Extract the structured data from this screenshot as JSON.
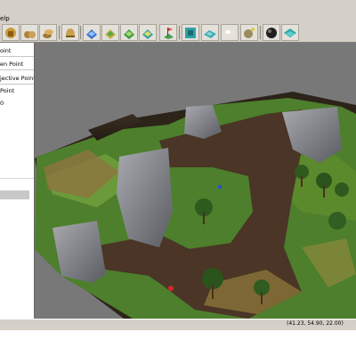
{
  "menu": {
    "help_label": "elp"
  },
  "toolbar": {
    "buttons": [
      {
        "icon": "unit-icon"
      },
      {
        "icon": "bags-icon"
      },
      {
        "icon": "coins-icon"
      },
      {
        "icon": "helmet-icon"
      },
      {
        "icon": "tiles-blue-icon"
      },
      {
        "icon": "tiles-yellow-icon"
      },
      {
        "icon": "tiles-green-icon"
      },
      {
        "icon": "tiles-teal-icon"
      },
      {
        "icon": "flag-icon"
      },
      {
        "icon": "terrain-icon"
      },
      {
        "icon": "cloud-icon"
      },
      {
        "icon": "sound-icon"
      },
      {
        "icon": "light-icon"
      },
      {
        "icon": "water-icon"
      }
    ]
  },
  "left_panel": {
    "items": [
      "oint",
      "en Point",
      "jective Point",
      "Point"
    ],
    "value_text": "0"
  },
  "status": {
    "coords": "(41.23, 54.90, 22.00)"
  },
  "colors": {
    "chrome": "#d4d0c8",
    "viewport_bg": "#787878"
  }
}
